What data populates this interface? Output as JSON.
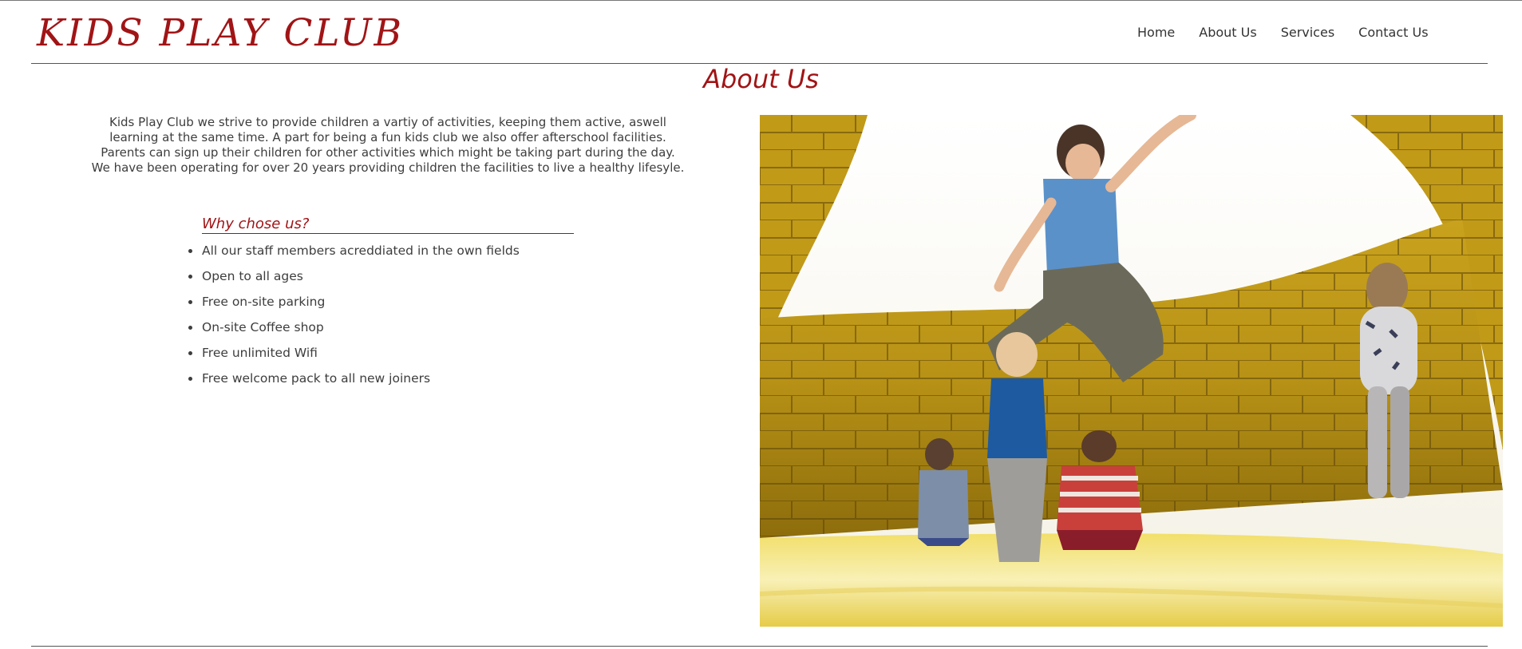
{
  "site": {
    "logo": "KIDS PLAY CLUB"
  },
  "nav": {
    "items": [
      {
        "label": "Home"
      },
      {
        "label": "About Us"
      },
      {
        "label": "Services"
      },
      {
        "label": "Contact Us"
      }
    ]
  },
  "main": {
    "title": "About Us",
    "intro": {
      "paragraph1": "Kids Play Club we strive to provide children a vartiy of activities, keeping them active, aswell learning at the same time. A part for being a fun kids club we also offer afterschool facilities. Parents can sign up their children for other activities which might be taking part during the day.",
      "paragraph2": "We have been operating for over 20 years providing children the facilities to live a healthy lifesyle."
    },
    "why": {
      "title": "Why chose us?",
      "items": [
        "All our staff members acreddiated in the own fields",
        "Open to all ages",
        "Free on-site parking",
        "On-site Coffee shop",
        "Free unlimited Wifi",
        "Free welcome pack to all new joiners"
      ]
    }
  },
  "colors": {
    "brand": "#a11416",
    "text": "#3d3d3d",
    "rule": "#555555"
  }
}
